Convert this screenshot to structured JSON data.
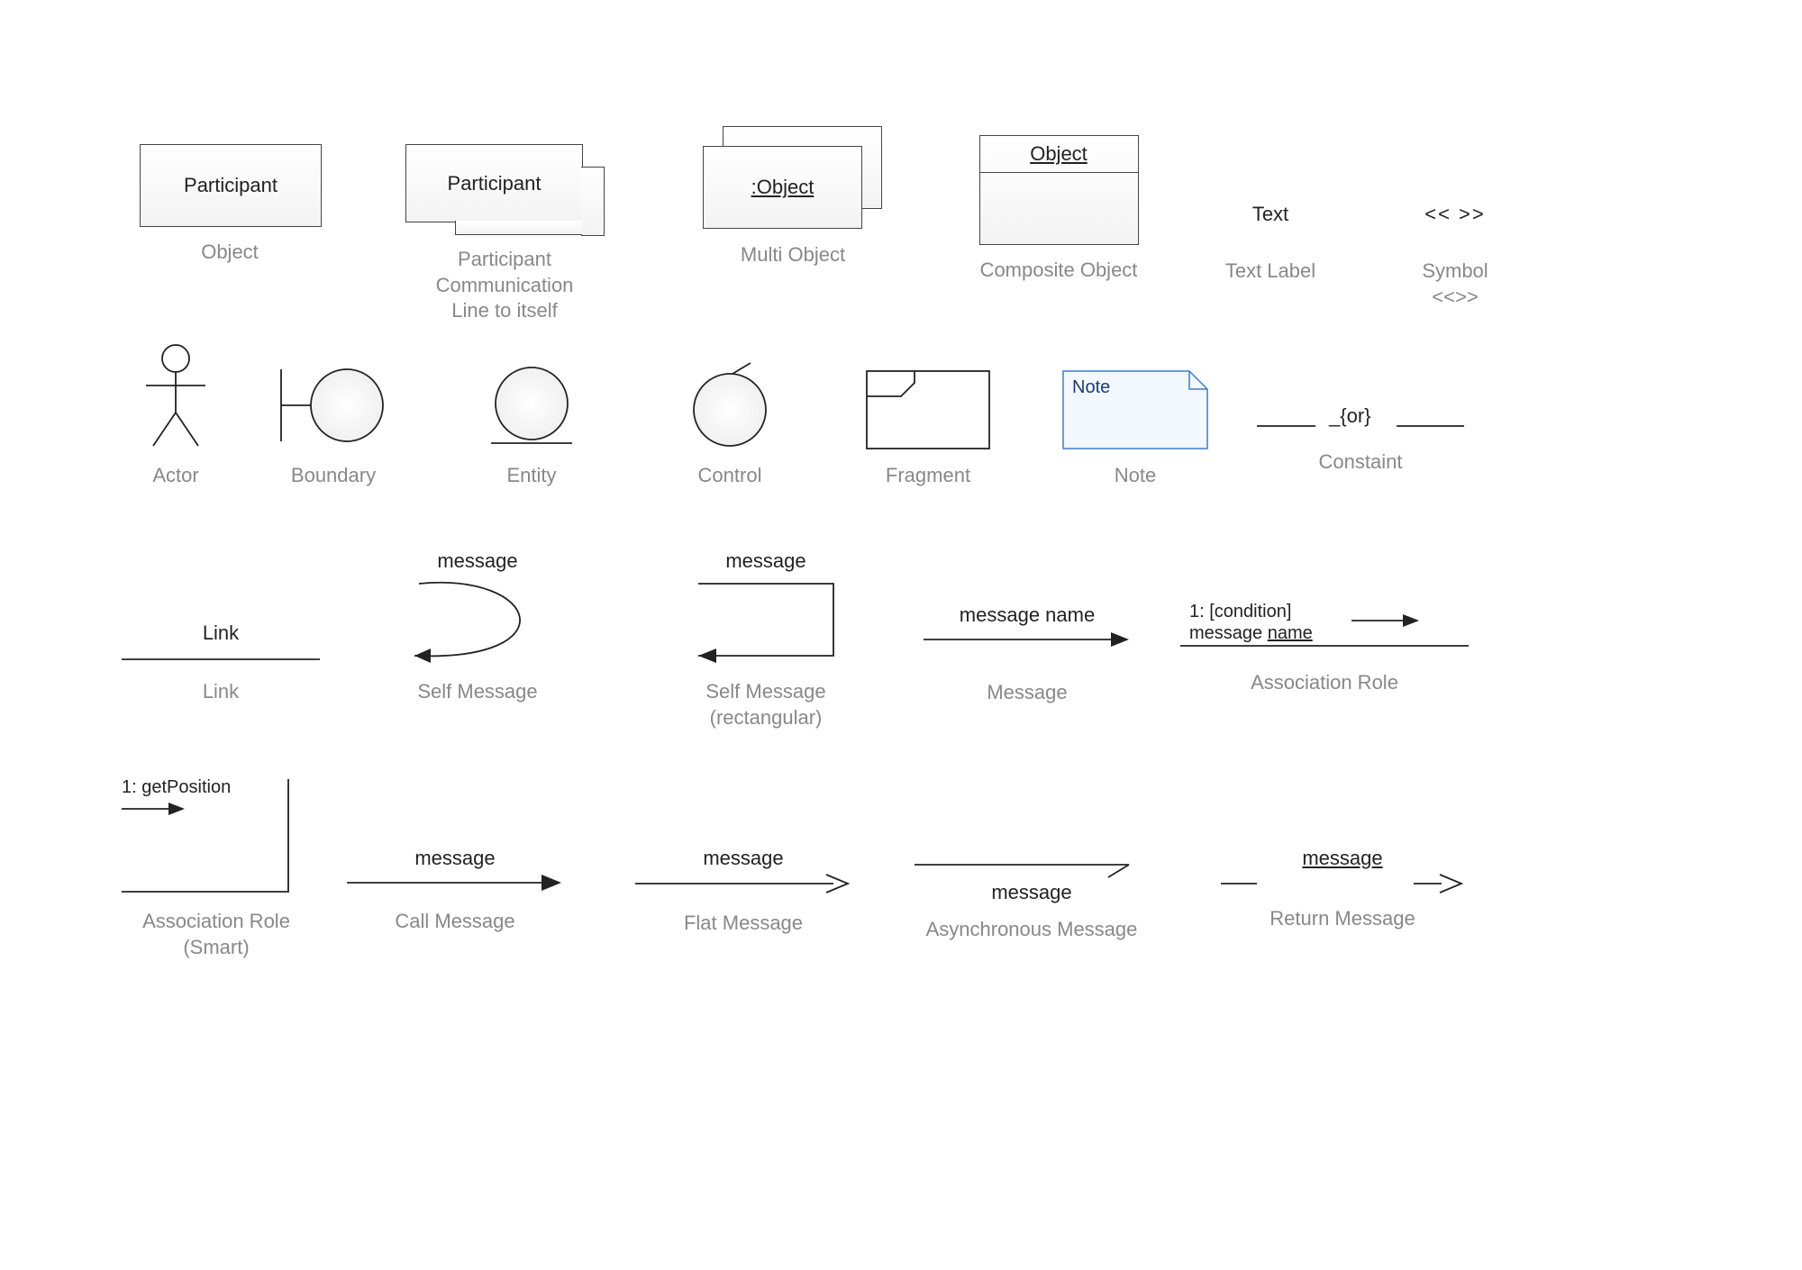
{
  "row1": {
    "object": {
      "cap": "Object",
      "label": "Participant"
    },
    "participant2": {
      "cap": "Participant Communication\nLine to itself",
      "label": "Participant"
    },
    "multiObject": {
      "cap": "Multi Object",
      "label": ":Object"
    },
    "composite": {
      "cap": "Composite Object",
      "label": "Object"
    },
    "textLabel": {
      "cap": "Text Label",
      "label": "Text"
    },
    "symbol": {
      "cap": "Symbol\n<<>>",
      "label": "<< >>"
    }
  },
  "row2": {
    "actor": "Actor",
    "boundary": "Boundary",
    "entity": "Entity",
    "control": "Control",
    "fragment": "Fragment",
    "note": {
      "cap": "Note",
      "label": "Note"
    },
    "constraint": {
      "cap": "Constaint",
      "label": "_{or}"
    }
  },
  "row3": {
    "link": {
      "cap": "Link",
      "label": "Link"
    },
    "selfMsg": {
      "cap": "Self Message",
      "label": "message"
    },
    "selfMsgRect": {
      "cap": "Self Message\n(rectangular)",
      "label": "message"
    },
    "message": {
      "cap": "Message",
      "label": "message name"
    },
    "assocRole": {
      "cap": "Association Role",
      "line1": "1: [condition]",
      "line2": "message name"
    }
  },
  "row4": {
    "assocSmart": {
      "cap": "Association Role\n(Smart)",
      "label": "1: getPosition"
    },
    "callMsg": {
      "cap": "Call Message",
      "label": "message"
    },
    "flatMsg": {
      "cap": "Flat Message",
      "label": "message"
    },
    "asyncMsg": {
      "cap": "Asynchronous Message",
      "label": "message"
    },
    "returnMsg": {
      "cap": "Return Message",
      "label": "message"
    }
  }
}
